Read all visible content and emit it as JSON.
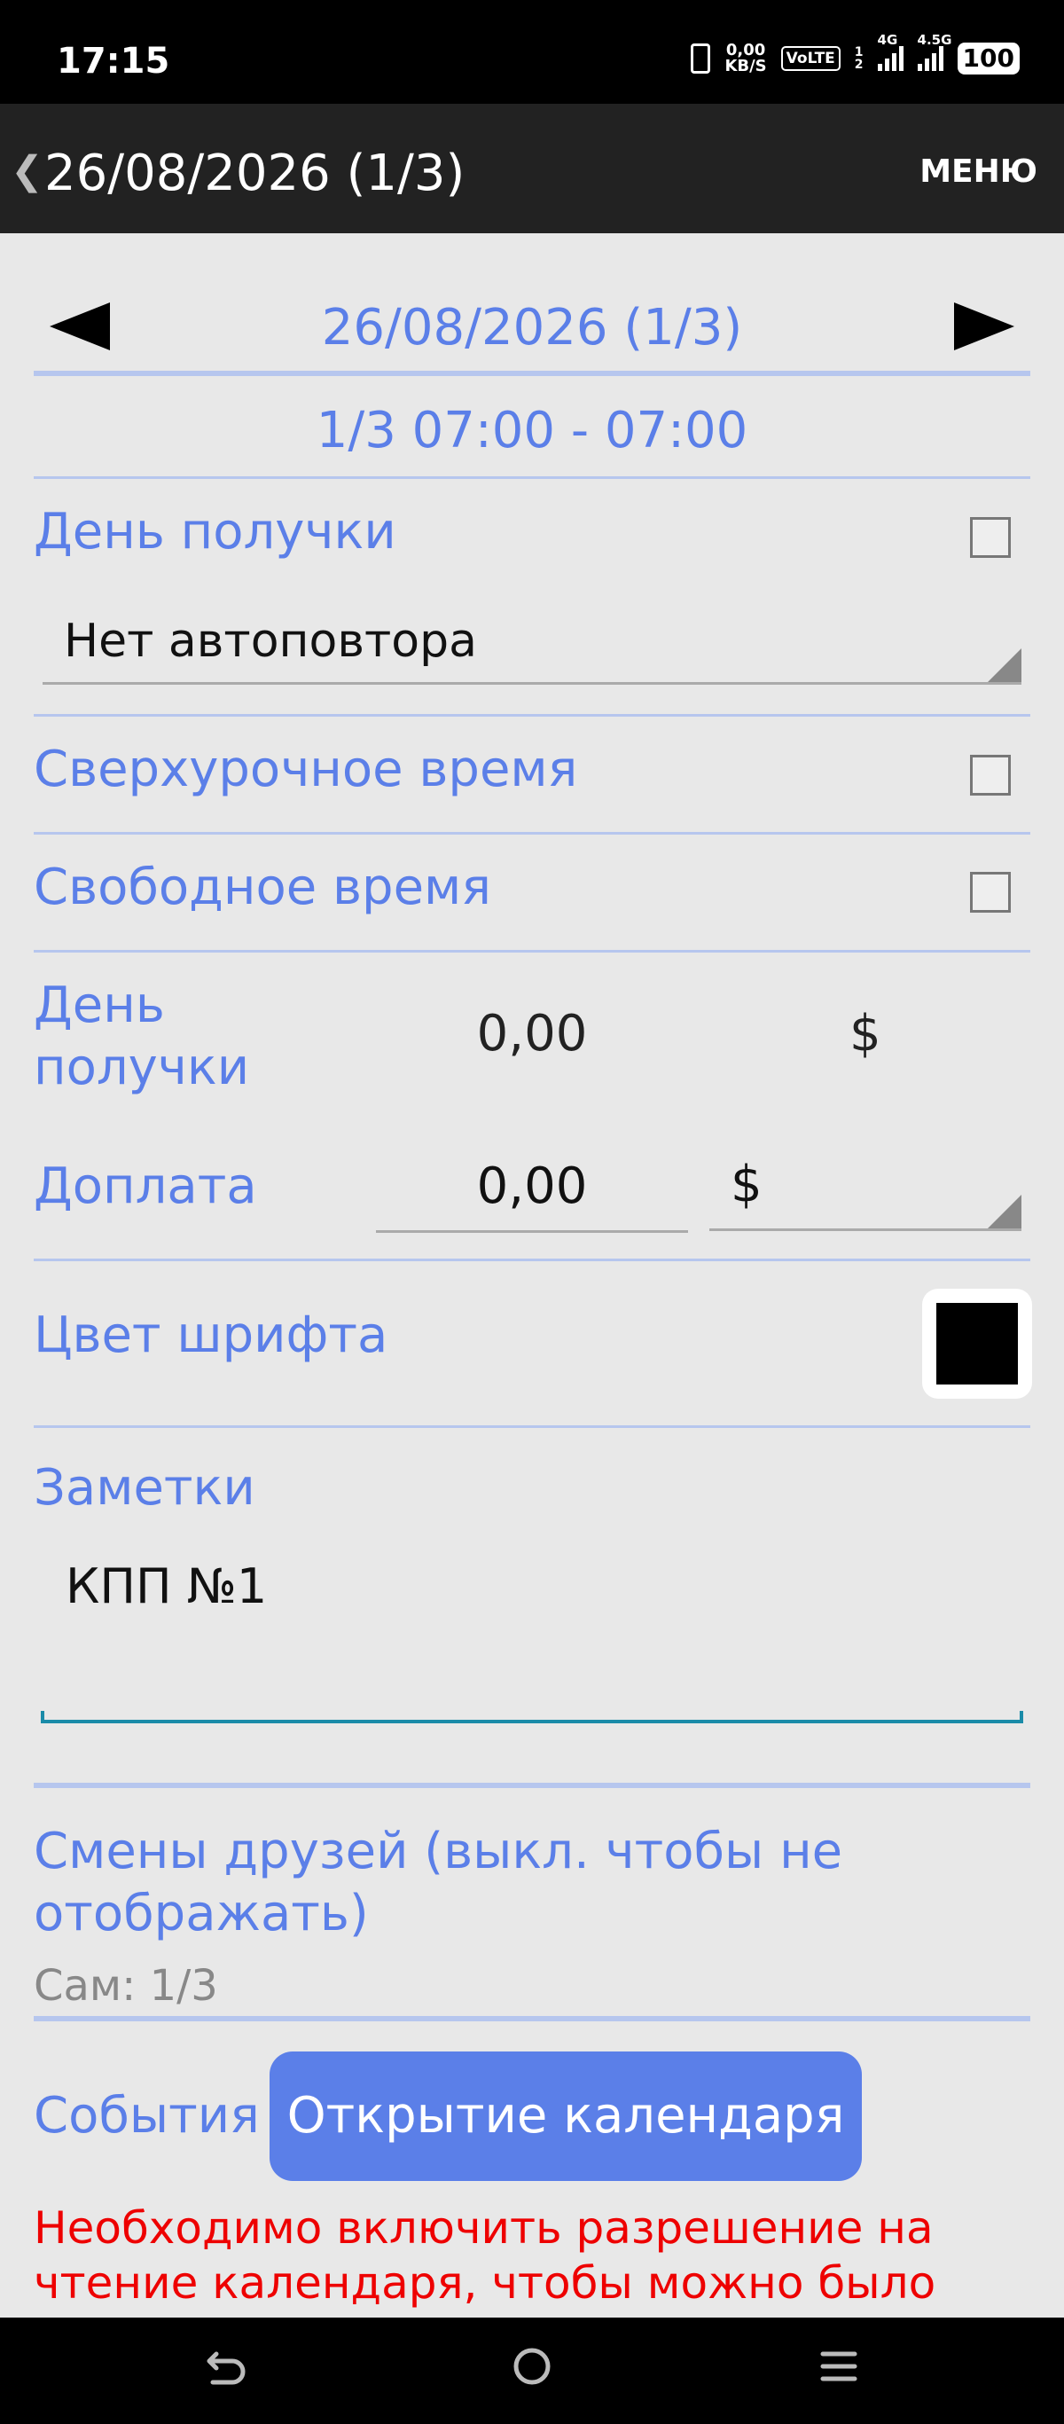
{
  "status_bar": {
    "time": "17:15",
    "net_speed_value": "0,00",
    "net_speed_unit": "KB/S",
    "volte": "VoLTE",
    "sim_top": "1",
    "sim_bottom": "2",
    "net1": "4G",
    "net2": "4.5G",
    "battery": "100"
  },
  "app_bar": {
    "back_glyph": "❮",
    "title": "26/08/2026 (1/3)",
    "menu_label": "МЕНЮ"
  },
  "date_nav": {
    "prev_glyph": "◀",
    "next_glyph": "▶",
    "date": "26/08/2026 (1/3)",
    "shift_time": "1/3 07:00 - 07:00"
  },
  "form": {
    "payday_label": "День получки",
    "payday_checked": false,
    "repeat_value": "Нет автоповтора",
    "overtime_label": "Сверхурочное время",
    "overtime_checked": false,
    "free_time_label": "Свободное время",
    "free_time_checked": false,
    "payday_amount_label_line1": "День",
    "payday_amount_label_line2": "получки",
    "payday_amount": "0,00",
    "payday_currency": "$",
    "bonus_label": "Доплата",
    "bonus_amount": "0,00",
    "bonus_currency": "$",
    "font_color_label": "Цвет шрифта",
    "font_color_value": "#000000",
    "notes_label": "Заметки",
    "notes_value": "КПП №1",
    "friends_label_line1": "Смены друзей (выкл. чтобы не",
    "friends_label_line2": "отображать)",
    "friends_self": "Сам: 1/3",
    "events_label": "События",
    "open_calendar_button": "Открытие календаря",
    "error_line1": "Необходимо включить разрешение на",
    "error_line2": "чтение календаря, чтобы можно было"
  },
  "nav_bar": {
    "back_icon": "back-icon",
    "home_icon": "home-icon",
    "recents_icon": "menu-icon"
  },
  "colors": {
    "accent": "#5b7fe8",
    "divider": "#b6c6ee",
    "error": "#ee0000",
    "background": "#e8e8e8"
  }
}
